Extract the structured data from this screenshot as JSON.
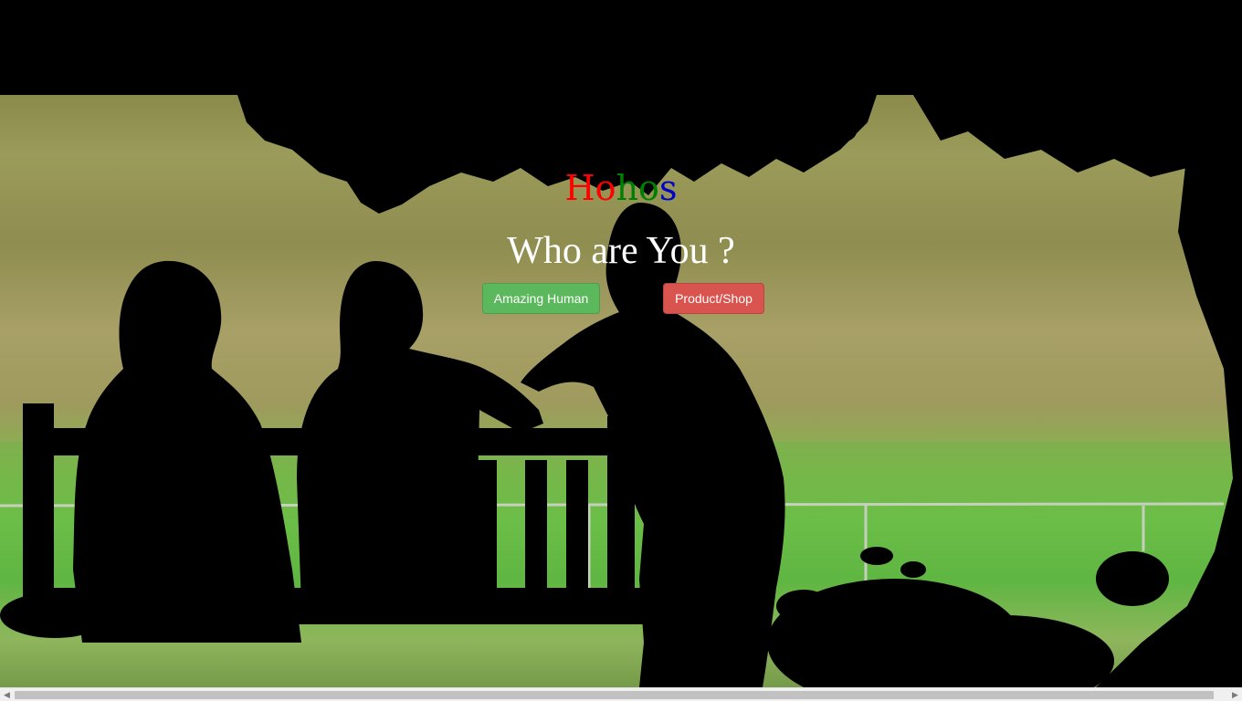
{
  "brand": {
    "letters": [
      {
        "char": "H",
        "color": "#ff0000"
      },
      {
        "char": "o",
        "color": "#ff0000"
      },
      {
        "char": "h",
        "color": "#008000"
      },
      {
        "char": "o",
        "color": "#008000"
      },
      {
        "char": "s",
        "color": "#0000cc"
      }
    ]
  },
  "hero": {
    "question": "Who are You ?"
  },
  "buttons": {
    "human": {
      "label": "Amazing Human",
      "color": "#5cb85c"
    },
    "shop": {
      "label": "Product/Shop",
      "color": "#d9534f"
    }
  },
  "scrollbar": {
    "left_arrow_icon": "chevron-left-icon",
    "right_arrow_icon": "chevron-right-icon"
  }
}
